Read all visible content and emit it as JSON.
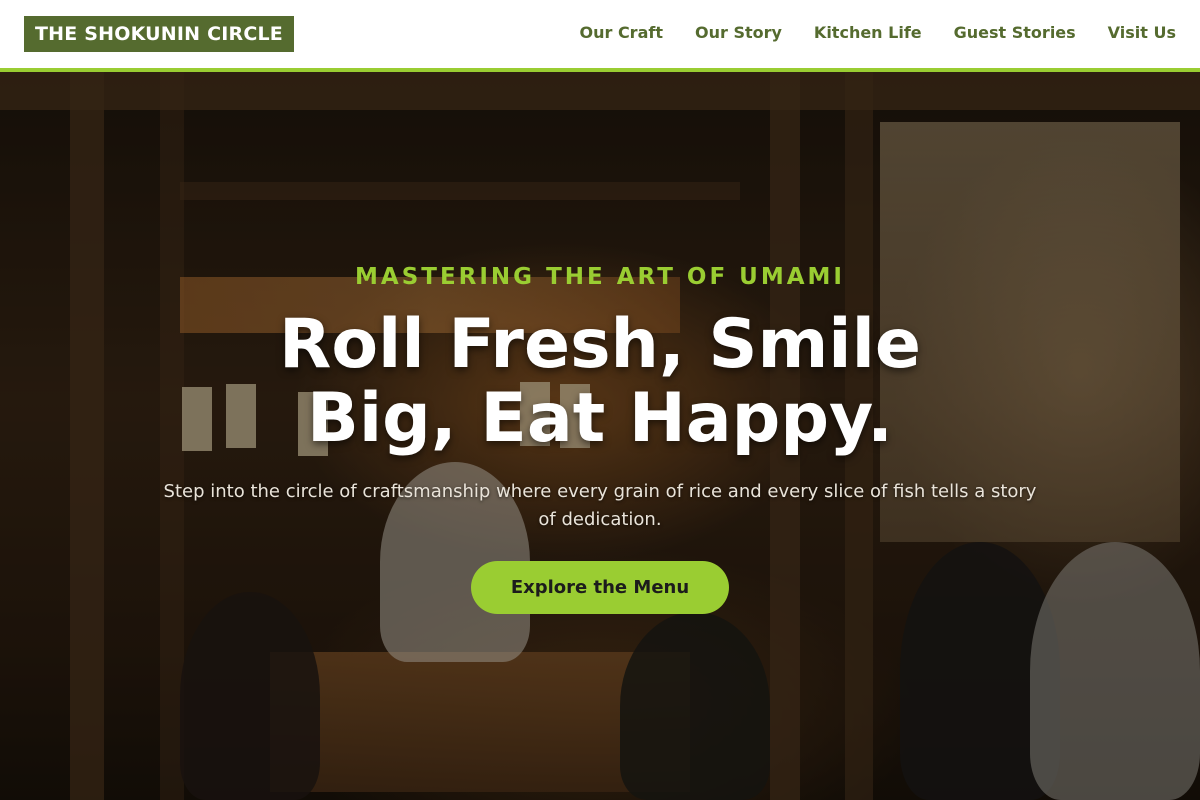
{
  "header": {
    "logo_text": "THE SHOKUNIN CIRCLE",
    "nav": [
      {
        "label": "Our Craft"
      },
      {
        "label": "Our Story"
      },
      {
        "label": "Kitchen Life"
      },
      {
        "label": "Guest Stories"
      },
      {
        "label": "Visit Us"
      }
    ]
  },
  "hero": {
    "eyebrow": "MASTERING THE ART OF UMAMI",
    "headline": "Roll Fresh, Smile Big, Eat Happy.",
    "subtext": "Step into the circle of craftsmanship where every grain of rice and every slice of fish tells a story of dedication.",
    "cta_label": "Explore the Menu",
    "background_image": "izakaya-restaurant-interior-photo"
  },
  "colors": {
    "brand_green": "#556b2f",
    "accent_lime": "#9acd32",
    "header_bg": "#ffffff"
  }
}
